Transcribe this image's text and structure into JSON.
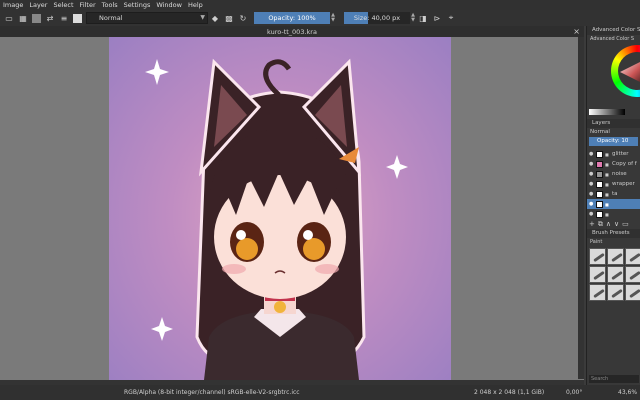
{
  "menu": [
    "Image",
    "Layer",
    "Select",
    "Filter",
    "Tools",
    "Settings",
    "Window",
    "Help"
  ],
  "toolbar": {
    "blend_mode": "Normal",
    "opacity": "Opacity: 100%",
    "size": "Size: 40,00 px"
  },
  "document": {
    "title": "kuro-tt_003.kra"
  },
  "docker": {
    "color_panel_title": "Advanced Color Se",
    "color_panel_sub": "Advanced Color S",
    "layers_title": "Layers",
    "layers_blend": "Normal",
    "layers_opacity": "Opacity: 10",
    "layers": [
      {
        "name": "glitter",
        "selected": false
      },
      {
        "name": "Copy of f",
        "selected": false
      },
      {
        "name": "noise",
        "selected": false
      },
      {
        "name": "wrapper",
        "selected": false
      },
      {
        "name": "ta",
        "selected": false
      },
      {
        "name": "",
        "selected": true
      },
      {
        "name": "",
        "selected": false
      },
      {
        "name": "",
        "selected": false
      }
    ],
    "brush_title": "Brush Presets",
    "brush_tag": "Paint",
    "search_placeholder": "Search"
  },
  "status": {
    "colorspace": "RGB/Alpha (8-bit integer/channel)  sRGB-elle-V2-srgbtrc.icc",
    "dimensions": "2 048 x 2 048 (1,1 GiB)",
    "rotation": "0,00°",
    "zoom": "43,6%"
  },
  "colors": {
    "accent": "#4e7fb6",
    "canvas_bg": "#7a7a7a",
    "art_bg": "#c08dc2"
  }
}
